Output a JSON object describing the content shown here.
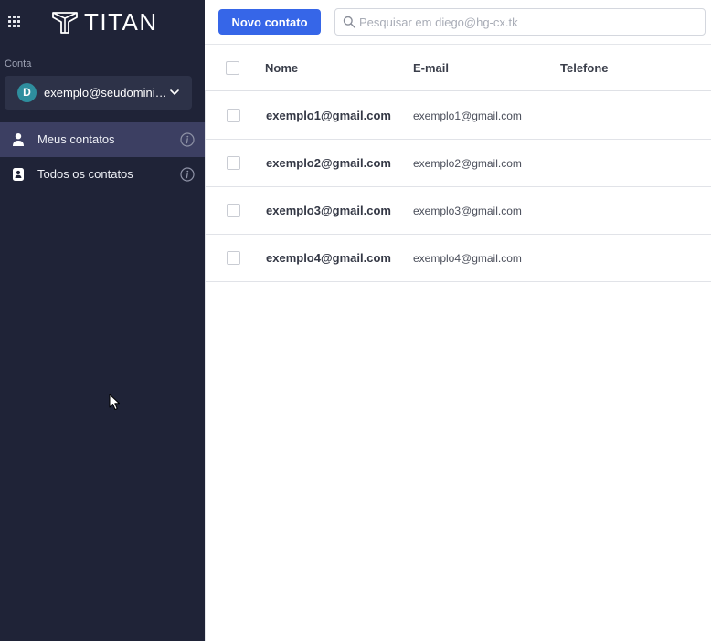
{
  "app": {
    "logo_text": "TITAN"
  },
  "sidebar": {
    "account_label": "Conta",
    "account": {
      "initial": "D",
      "email": "exemplo@seudominio.com"
    },
    "items": [
      {
        "label": "Meus contatos",
        "icon": "person-icon",
        "active": true
      },
      {
        "label": "Todos os contatos",
        "icon": "contact-book-icon",
        "active": false
      }
    ]
  },
  "toolbar": {
    "new_contact_label": "Novo contato",
    "search_placeholder": "Pesquisar em diego@hg-cx.tk"
  },
  "table": {
    "columns": [
      "Nome",
      "E-mail",
      "Telefone"
    ],
    "rows": [
      {
        "name": "exemplo1@gmail.com",
        "email": "exemplo1@gmail.com",
        "phone": ""
      },
      {
        "name": "exemplo2@gmail.com",
        "email": "exemplo2@gmail.com",
        "phone": ""
      },
      {
        "name": "exemplo3@gmail.com",
        "email": "exemplo3@gmail.com",
        "phone": ""
      },
      {
        "name": "exemplo4@gmail.com",
        "email": "exemplo4@gmail.com",
        "phone": ""
      }
    ]
  },
  "colors": {
    "sidebar_bg": "#1f2337",
    "sidebar_active": "#3c3f62",
    "accent": "#3666e8",
    "avatar": "#2e8e9e"
  }
}
